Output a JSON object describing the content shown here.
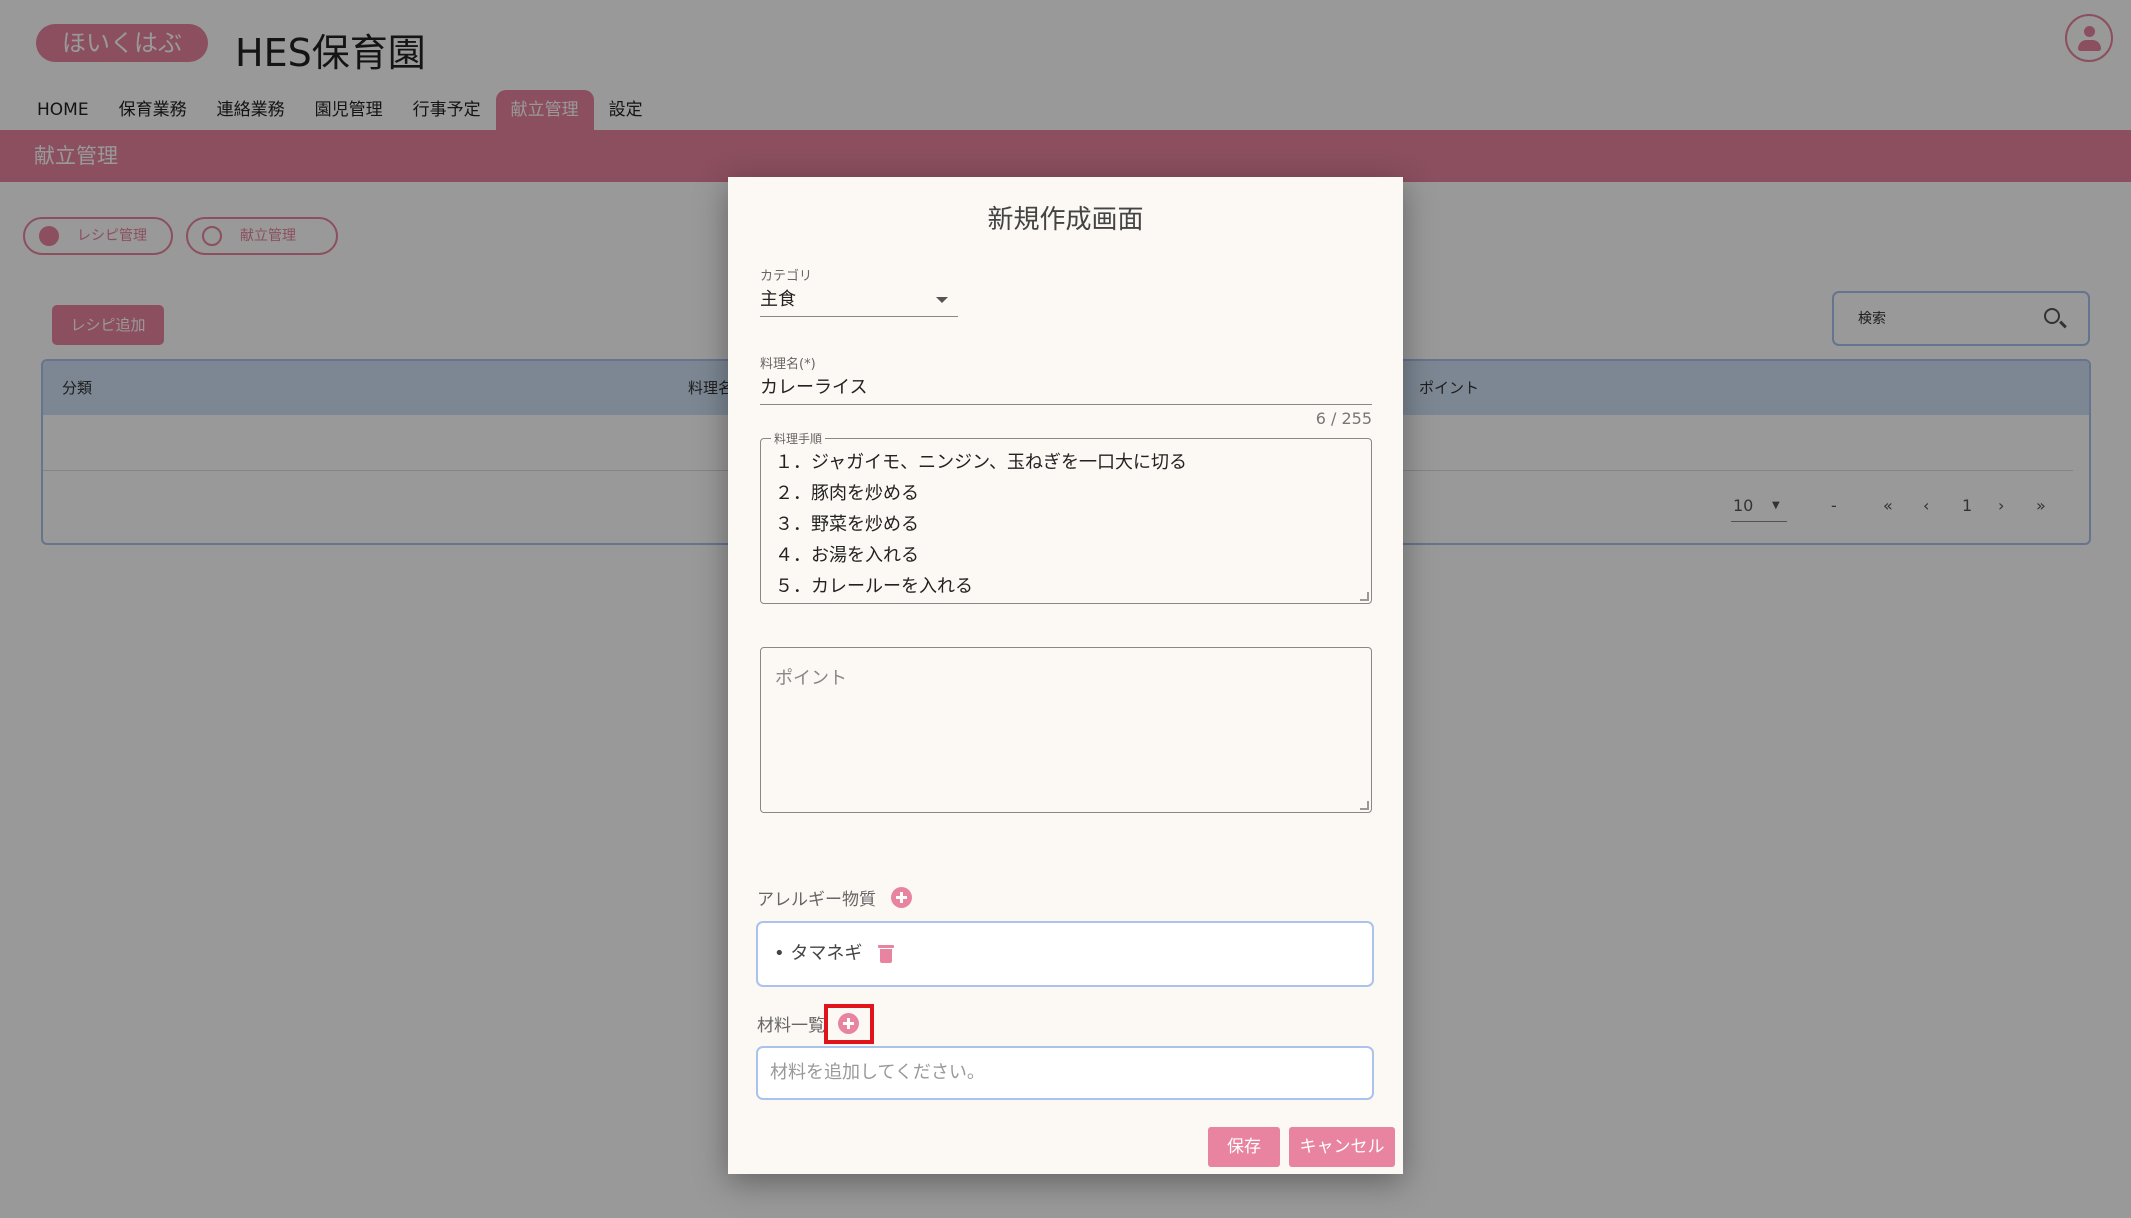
{
  "header": {
    "logo_text": "ほいくはぶ",
    "site_title": "HES保育園"
  },
  "nav": {
    "items": [
      "HOME",
      "保育業務",
      "連絡業務",
      "園児管理",
      "行事予定",
      "献立管理",
      "設定"
    ],
    "active_index": 5
  },
  "page": {
    "title": "献立管理",
    "pills": [
      "レシピ管理",
      "献立管理"
    ],
    "add_recipe_label": "レシピ追加",
    "search_label": "検索"
  },
  "table": {
    "columns": [
      "分類",
      "料理名",
      "ポイント"
    ],
    "pager": {
      "per_page": "10",
      "range": "-",
      "first": "«",
      "prev": "‹",
      "page": "1",
      "next": "›",
      "last": "»"
    }
  },
  "dialog": {
    "title": "新規作成画面",
    "category": {
      "label": "カテゴリ",
      "value": "主食"
    },
    "dish_name": {
      "label": "料理名(*)",
      "value": "カレーライス",
      "counter": "6 / 255"
    },
    "steps": {
      "label": "料理手順",
      "lines": [
        "１．ジャガイモ、ニンジン、玉ねぎを一口大に切る",
        "２．豚肉を炒める",
        "３．野菜を炒める",
        "４．お湯を入れる",
        "５．カレールーを入れる"
      ]
    },
    "point": {
      "placeholder": "ポイント"
    },
    "allergy": {
      "label": "アレルギー物質",
      "items": [
        "タマネギ"
      ]
    },
    "materials": {
      "label": "材料一覧",
      "placeholder": "材料を追加してください。"
    },
    "buttons": {
      "save": "保存",
      "cancel": "キャンセル"
    }
  },
  "colors": {
    "accent": "#e8849f",
    "border_blue": "#aac2ec",
    "highlight": "#e0141b"
  }
}
